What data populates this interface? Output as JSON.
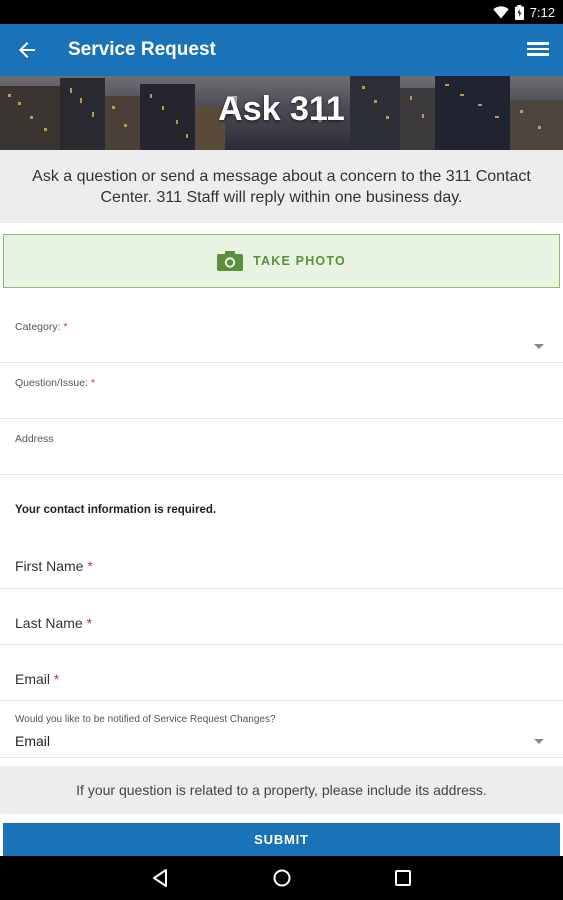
{
  "status_bar": {
    "time": "7:12"
  },
  "app_bar": {
    "title": "Service Request"
  },
  "hero": {
    "title": "Ask 311"
  },
  "intro": {
    "text": "Ask a question or send a message about a concern to the 311 Contact Center. 311 Staff will reply within one business day."
  },
  "photo_button": {
    "label": "TAKE PHOTO"
  },
  "form": {
    "category": {
      "label": "Category:",
      "required_mark": "*",
      "value": ""
    },
    "question": {
      "label": "Question/Issue:",
      "required_mark": "*",
      "value": ""
    },
    "address": {
      "label": "Address",
      "value": ""
    },
    "contact_note": "Your contact information is required.",
    "first_name": {
      "label": "First Name",
      "required_mark": "*"
    },
    "last_name": {
      "label": "Last Name",
      "required_mark": "*"
    },
    "email": {
      "label": "Email",
      "required_mark": "*"
    },
    "notify": {
      "label": "Would you like to be notified of Service Request Changes?",
      "value": "Email"
    }
  },
  "hint": "If your question is related to a property, please include its address.",
  "submit_label": "SUBMIT",
  "colors": {
    "primary": "#1a72b8",
    "photo_bg": "#e8f3e1",
    "photo_green": "#5c8f3d",
    "required": "#d32f2f"
  },
  "icons": {
    "back": "arrow-left-icon",
    "menu": "hamburger-menu-icon",
    "camera": "camera-icon",
    "wifi": "wifi-icon",
    "battery": "battery-icon"
  }
}
